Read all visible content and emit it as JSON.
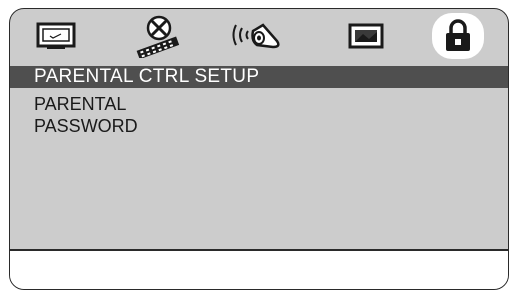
{
  "tabs": [
    {
      "icon": "tv-icon",
      "active": false
    },
    {
      "icon": "film-reel-icon",
      "active": false
    },
    {
      "icon": "speaker-audio-icon",
      "active": false
    },
    {
      "icon": "video-picture-icon",
      "active": false
    },
    {
      "icon": "lock-icon",
      "active": true
    }
  ],
  "header": {
    "title": "PARENTAL CTRL SETUP"
  },
  "menu": {
    "items": [
      {
        "label": "PARENTAL"
      },
      {
        "label": "PASSWORD"
      }
    ]
  },
  "colors": {
    "screen_bg": "#cccccc",
    "header_bg": "#4f4f4f",
    "active_tab_bg": "#ffffff"
  }
}
